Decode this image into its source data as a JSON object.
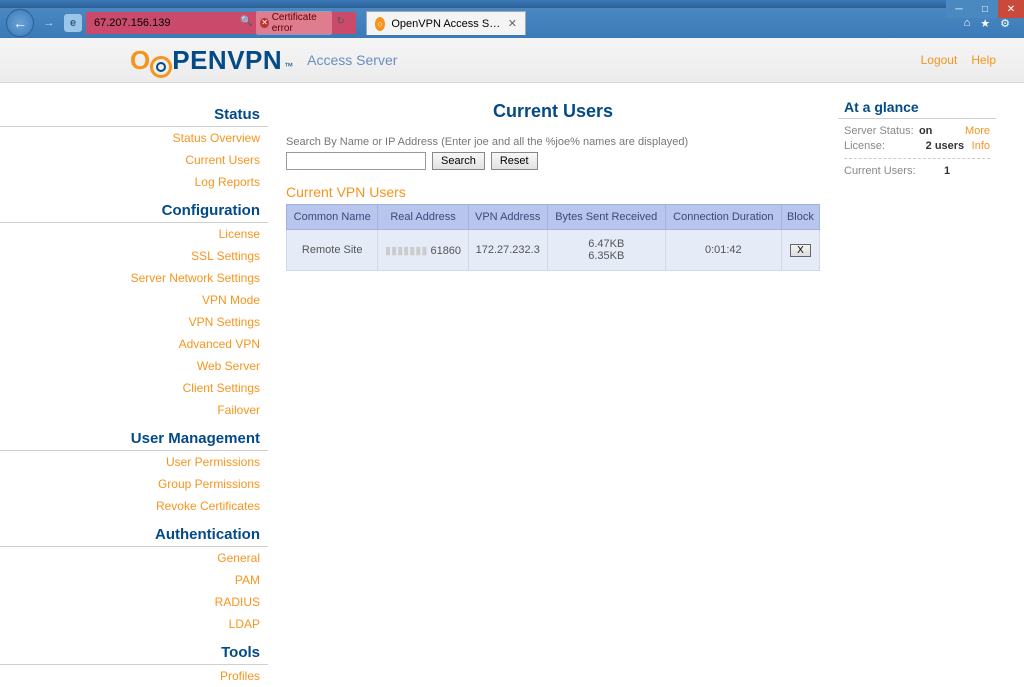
{
  "browser": {
    "url": "67.207.156.139",
    "cert_error": "Certificate error",
    "tab_title": "OpenVPN Access Server Cu..."
  },
  "header": {
    "logo_prefix": "O",
    "logo_rest": "PENVPN",
    "subtitle": "Access Server",
    "logout": "Logout",
    "help": "Help"
  },
  "sidebar": {
    "status": {
      "h": "Status",
      "items": [
        "Status Overview",
        "Current Users",
        "Log Reports"
      ]
    },
    "config": {
      "h": "Configuration",
      "items": [
        "License",
        "SSL Settings",
        "Server Network Settings",
        "VPN Mode",
        "VPN Settings",
        "Advanced VPN",
        "Web Server",
        "Client Settings",
        "Failover"
      ]
    },
    "users": {
      "h": "User Management",
      "items": [
        "User Permissions",
        "Group Permissions",
        "Revoke Certificates"
      ]
    },
    "auth": {
      "h": "Authentication",
      "items": [
        "General",
        "PAM",
        "RADIUS",
        "LDAP"
      ]
    },
    "tools": {
      "h": "Tools",
      "items": [
        "Profiles"
      ]
    }
  },
  "main": {
    "title": "Current Users",
    "search_label": "Search By Name or IP Address (Enter joe and all the %joe% names are displayed)",
    "btn_search": "Search",
    "btn_reset": "Reset",
    "sub_h": "Current VPN Users",
    "cols": {
      "c1": "Common Name",
      "c2": "Real Address",
      "c3": "VPN Address",
      "c4": "Bytes Sent Received",
      "c5": "Connection Duration",
      "c6": "Block"
    },
    "row": {
      "name": "Remote Site",
      "real": "61860",
      "vpn": "172.27.232.3",
      "sent": "6.47KB",
      "recv": "6.35KB",
      "dur": "0:01:42",
      "block": "X"
    }
  },
  "aside": {
    "h": "At a glance",
    "status_lbl": "Server Status:",
    "status_val": "on",
    "license_lbl": "License:",
    "license_val": "2 users",
    "more": "More",
    "info": "Info",
    "cur_lbl": "Current Users:",
    "cur_val": "1"
  }
}
